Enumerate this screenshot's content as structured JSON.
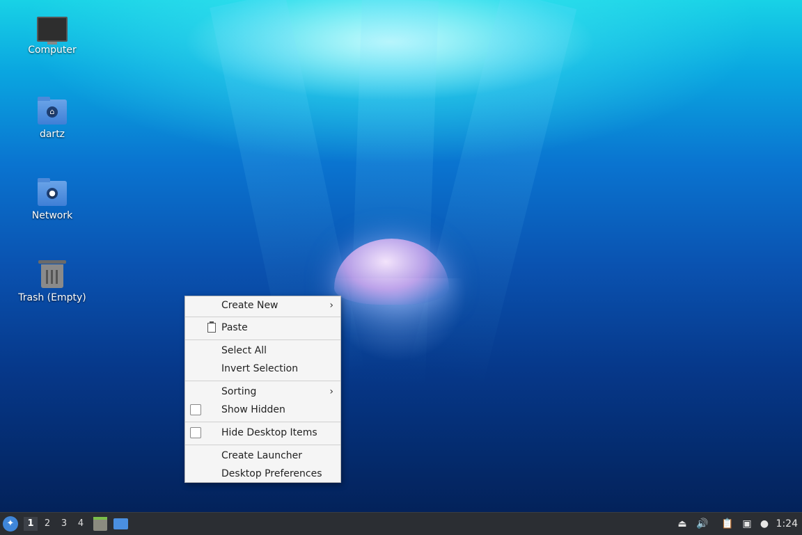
{
  "desktop": {
    "icons": [
      {
        "label": "Computer",
        "icon": "computer-icon"
      },
      {
        "label": "dartz",
        "icon": "home-folder-icon"
      },
      {
        "label": "Network",
        "icon": "network-folder-icon"
      },
      {
        "label": "Trash (Empty)",
        "icon": "trash-icon"
      }
    ]
  },
  "context_menu": {
    "items": [
      {
        "label": "Create New",
        "submenu": true
      },
      {
        "label": "Paste",
        "icon": "paste-icon"
      },
      {
        "label": "Select All"
      },
      {
        "label": "Invert Selection"
      },
      {
        "label": "Sorting",
        "submenu": true
      },
      {
        "label": "Show Hidden",
        "checkbox": true,
        "checked": false
      },
      {
        "label": "Hide Desktop Items",
        "checkbox": true,
        "checked": false
      },
      {
        "label": "Create Launcher"
      },
      {
        "label": "Desktop Preferences"
      }
    ]
  },
  "taskbar": {
    "workspaces": [
      "1",
      "2",
      "3",
      "4"
    ],
    "active_workspace": "1",
    "clock": "1:24",
    "tray_icons": [
      "eject-icon",
      "volume-icon",
      "clipboard-icon",
      "network-icon",
      "notification-icon"
    ]
  },
  "colors": {
    "taskbar_bg": "#2b2e33",
    "menu_bg": "#f5f5f5",
    "accent": "#3f86d9"
  }
}
